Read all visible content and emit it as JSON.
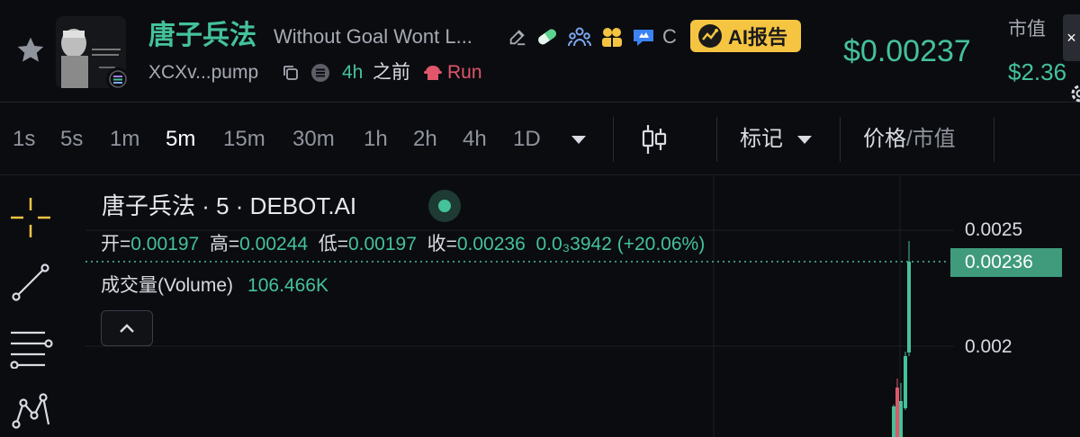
{
  "header": {
    "token_name": "唐子兵法",
    "description": "Without Goal Wont L...",
    "ai_report_label": "AI报告",
    "c_label": "C",
    "address": "XCXv...pump",
    "age_value": "4h",
    "age_suffix": "之前",
    "run_label": "Run",
    "price": "$0.00237",
    "market_cap_label": "市值",
    "market_cap_value": "$2.36",
    "close_label": "×",
    "icons": [
      "star-icon",
      "edit-icon",
      "pill-icon",
      "holders-icon",
      "community-icon",
      "twitter-bird-icon",
      "copy-icon",
      "chain-icon",
      "run-icon",
      "gear-icon"
    ]
  },
  "toolbar": {
    "timeframes": [
      {
        "label": "1s",
        "active": false
      },
      {
        "label": "5s",
        "active": false
      },
      {
        "label": "1m",
        "active": false
      },
      {
        "label": "5m",
        "active": true
      },
      {
        "label": "15m",
        "active": false
      },
      {
        "label": "30m",
        "active": false
      },
      {
        "label": "1h",
        "active": false
      },
      {
        "label": "2h",
        "active": false
      },
      {
        "label": "4h",
        "active": false
      },
      {
        "label": "1D",
        "active": false
      }
    ],
    "mark_label": "标记",
    "price_label": "价格",
    "slash": "/",
    "mcap_label": "市值"
  },
  "chart": {
    "title": "唐子兵法 · 5 · DEBOT.AI",
    "ohlc": {
      "open_label": "开=",
      "open": "0.00197",
      "high_label": "高=",
      "high": "0.00244",
      "low_label": "低=",
      "low": "0.00197",
      "close_label": "收=",
      "close": "0.00236",
      "change": "0.0₃3942 (+20.06%)"
    },
    "volume_label": "成交量(Volume)",
    "volume_value": "106.466K",
    "price_axis": [
      "0.0025",
      "0.002"
    ],
    "current_price_tag": "0.00236",
    "colors": {
      "up": "#44c29a",
      "down": "#e0566b",
      "accent": "#f5c542"
    }
  }
}
